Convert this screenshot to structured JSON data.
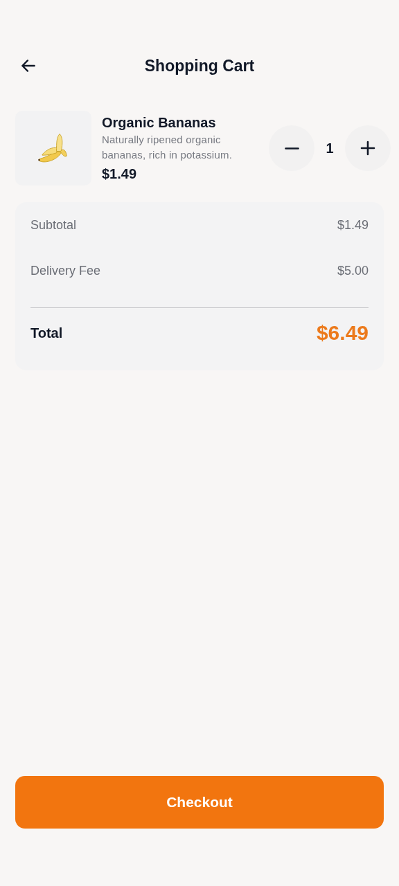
{
  "header": {
    "title": "Shopping Cart"
  },
  "items": [
    {
      "name": "Organic Bananas",
      "description": "Naturally ripened organic bananas, rich in potassium.",
      "price": "$1.49",
      "quantity": "1"
    }
  ],
  "summary": [
    {
      "kind": "line",
      "label": "Subtotal",
      "value": "$1.49"
    },
    {
      "kind": "line",
      "label": "Delivery Fee",
      "value": "$5.00"
    },
    {
      "kind": "total",
      "label": "Total",
      "value": "$6.49"
    }
  ],
  "checkout_button": {
    "label": "Checkout"
  }
}
